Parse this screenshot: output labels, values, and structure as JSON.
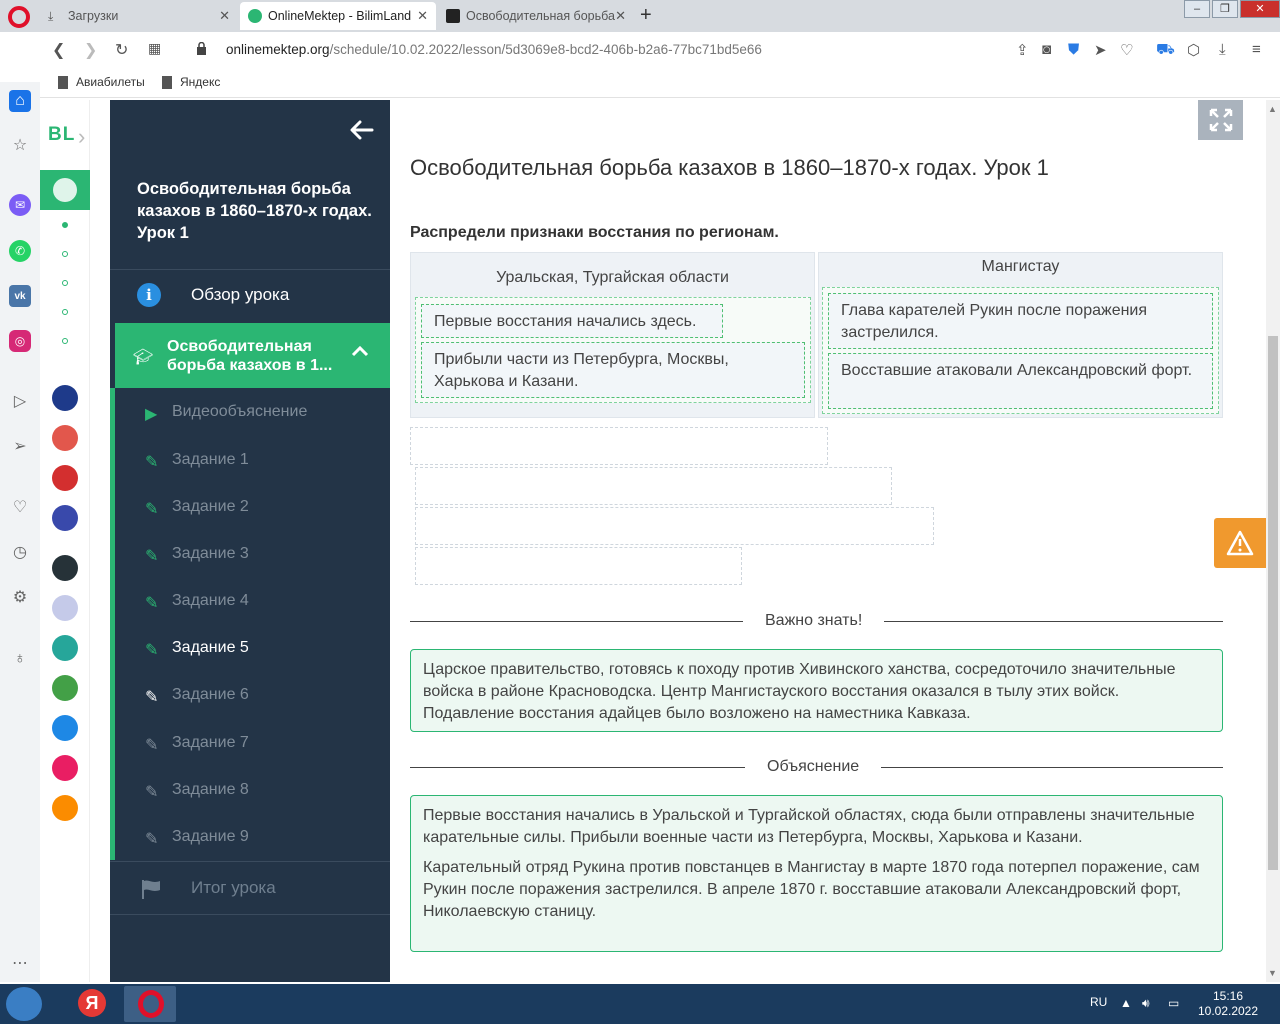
{
  "browser": {
    "tabs": [
      {
        "label": "Загрузки"
      },
      {
        "label": "OnlineMektep - BilimLand"
      },
      {
        "label": "Освободительная борьба"
      }
    ],
    "url_host": "onlinemektep.org",
    "url_path": "/schedule/10.02.2022/lesson/5d3069e8-bcd2-406b-b2a6-77bc71bd5e66",
    "bookmarks": [
      "Авиабилеты",
      "Яндекс"
    ]
  },
  "rail": {
    "logo": "BL"
  },
  "sidebar": {
    "course_title": "Освободительная борьба казахов в 1860–1870-х годах. Урок 1",
    "overview_label": "Обзор урока",
    "section_label": "Освободительная борьба казахов в 1...",
    "items": [
      {
        "label": "Видеообъяснение"
      },
      {
        "label": "Задание 1"
      },
      {
        "label": "Задание 2"
      },
      {
        "label": "Задание 3"
      },
      {
        "label": "Задание 4"
      },
      {
        "label": "Задание 5"
      },
      {
        "label": "Задание 6"
      },
      {
        "label": "Задание 7"
      },
      {
        "label": "Задание 8"
      },
      {
        "label": "Задание 9"
      }
    ],
    "final_label": "Итог урока"
  },
  "main": {
    "title": "Освободительная борьба казахов в 1860–1870-х годах. Урок 1",
    "instruction": "Распредели признаки восстания по регионам.",
    "columns": [
      {
        "header": "Уральская, Тургайская области",
        "cards": [
          "Первые восстания начались здесь.",
          "Прибыли части из Петербурга, Москвы, Харькова и Казани."
        ]
      },
      {
        "header": "Мангистау",
        "cards": [
          "Глава карателей Рукин после поражения застрелился.",
          "Восставшие атаковали Александровский форт."
        ]
      }
    ],
    "important_label": "Важно знать!",
    "important_text": "Царское правительство, готовясь к походу против Хивинского ханства, сосредоточило значительные войска в районе Красноводска. Центр Мангистауского восстания оказался в тылу этих войск. Подавление восстания адайцев было возложено на наместника Кавказа.",
    "explanation_label": "Объяснение",
    "explanation_p1": "Первые восстания начались в Уральской и Тургайской областях, сюда были отправлены значительные карательные силы. Прибыли военные части из Петербурга, Москвы, Харькова и Казани.",
    "explanation_p2": "Карательный отряд Рукина против повстанцев в Мангистау в марте 1870 года потерпел поражение, сам Рукин после поражения застрелился. В апреле 1870 г. восставшие атаковали Александровский форт, Николаевскую станицу."
  },
  "taskbar": {
    "lang": "RU",
    "time": "15:16",
    "date": "10.02.2022"
  },
  "colors": {
    "accent": "#2bb673",
    "sidebar_bg": "#233447",
    "warning": "#f0992e"
  }
}
